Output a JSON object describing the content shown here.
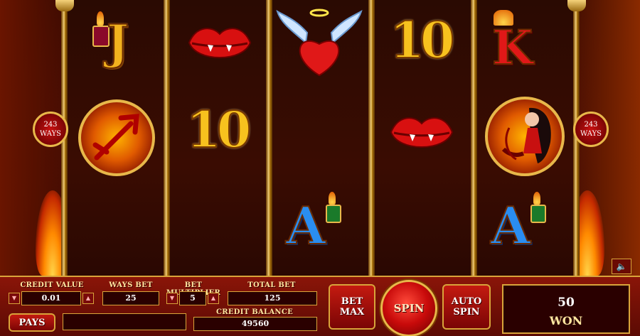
{
  "ways_badge": {
    "number": "243",
    "word": "WAYS"
  },
  "reels": {
    "r1": [
      "J",
      "trident",
      ""
    ],
    "r2": [
      "lips",
      "10",
      ""
    ],
    "r3": [
      "winged-heart",
      "",
      "A"
    ],
    "r4": [
      "10",
      "lips",
      ""
    ],
    "r5": [
      "K",
      "devil-girl",
      "A"
    ]
  },
  "symbols": {
    "j": "J",
    "k": "K",
    "ten": "10",
    "ace": "A"
  },
  "panel": {
    "credit_value_label": "CREDIT VALUE",
    "credit_value": "0.01",
    "ways_bet_label": "WAYS BET",
    "ways_bet": "25",
    "bet_multiplier_label": "BET MULTIPLIER",
    "bet_multiplier": "5",
    "total_bet_label": "TOTAL BET",
    "total_bet": "125",
    "credit_balance_label": "CREDIT BALANCE",
    "credit_balance": "49560",
    "pays_label": "PAYS",
    "bet_max_label": "BET MAX",
    "spin_label": "SPIN",
    "auto_spin_label": "AUTO SPIN",
    "won_amount": "50",
    "won_label": "WON"
  },
  "colors": {
    "accent": "#d8a43a",
    "panel": "#8a1508",
    "spin": "#c80a0a"
  }
}
